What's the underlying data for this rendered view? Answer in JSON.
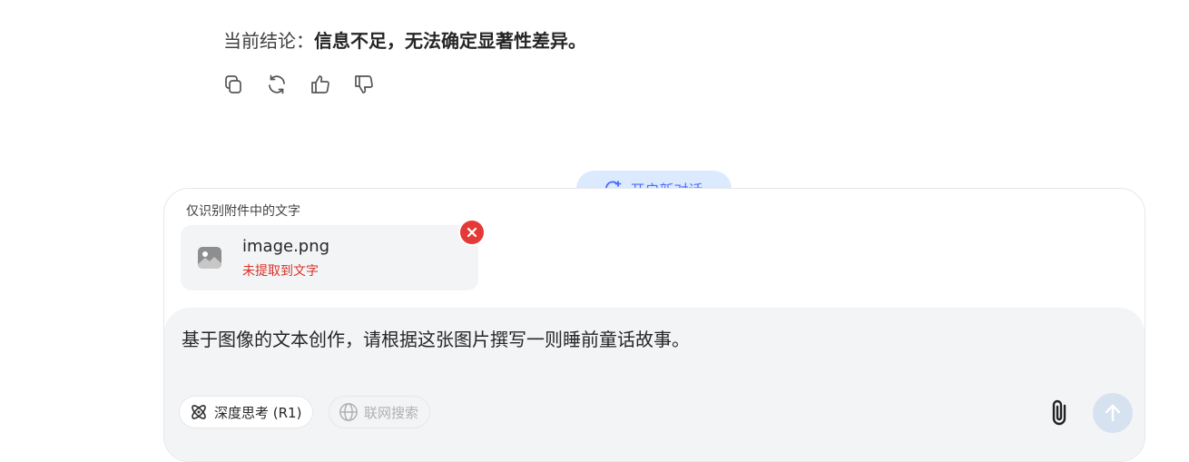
{
  "message": {
    "conclusion_prefix": "当前结论：",
    "conclusion_text": "信息不足，无法确定显著性差异。"
  },
  "message_actions": {
    "icons": [
      "copy-icon",
      "regenerate-icon",
      "thumbs-up-icon",
      "thumbs-down-icon"
    ]
  },
  "new_chat": {
    "label": "开启新对话",
    "icon": "new-chat-icon"
  },
  "composer": {
    "attachment_label": "仅识别附件中的文字",
    "file": {
      "name": "image.png",
      "status": "未提取到文字",
      "icon": "image-file-icon"
    },
    "input_value": "基于图像的文本创作，请根据这张图片撰写一则睡前童话故事。",
    "deep_think": {
      "label": "深度思考 (R1)",
      "icon": "deep-think-icon",
      "enabled": false
    },
    "web_search": {
      "label": "联网搜索",
      "icon": "globe-icon",
      "enabled": false
    },
    "attach_icon": "paperclip-icon",
    "send_icon": "send-arrow-icon"
  },
  "colors": {
    "accent": "#4d6bfe",
    "accent_bg": "#dbeafe",
    "error": "#d93025",
    "remove_button": "#e53935",
    "input_bg": "#f3f4f6",
    "send_disabled": "#d6e2ef"
  }
}
